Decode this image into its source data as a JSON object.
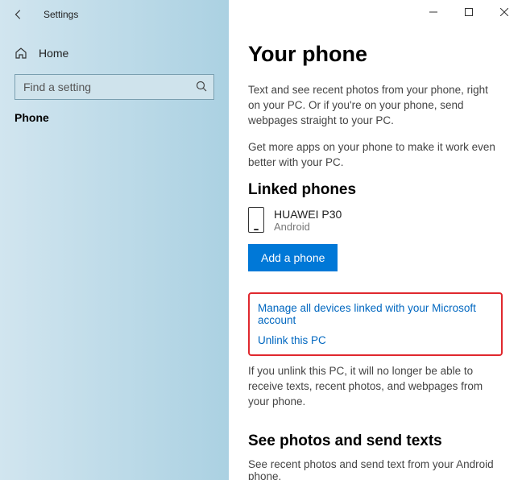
{
  "app_title": "Settings",
  "sidebar": {
    "home_label": "Home",
    "search_placeholder": "Find a setting",
    "nav_phone": "Phone"
  },
  "main": {
    "heading": "Your phone",
    "desc1": "Text and see recent photos from your phone, right on your PC. Or if you're on your phone, send webpages straight to your PC.",
    "desc2": "Get more apps on your phone to make it work even better with your PC.",
    "linked_heading": "Linked phones",
    "phone_name": "HUAWEI P30",
    "phone_os": "Android",
    "add_button": "Add a phone",
    "link_manage": "Manage all devices linked with your Microsoft account",
    "link_unlink": "Unlink this PC",
    "unlink_note": "If you unlink this PC, it will no longer be able to receive texts, recent photos, and webpages from your phone.",
    "photos_heading": "See photos and send texts",
    "photos_desc": "See recent photos and send text from your Android phone."
  }
}
